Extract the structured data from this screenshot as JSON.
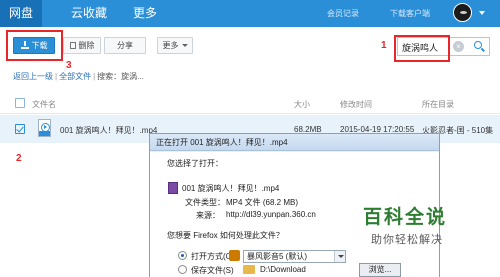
{
  "nav": {
    "tabs": [
      "网盘",
      "云收藏",
      "更多"
    ],
    "right_links": [
      "会员记录",
      "下载客户端"
    ]
  },
  "toolbar": {
    "download": "下载",
    "delete": "删除",
    "share": "分享",
    "more": "更多"
  },
  "search": {
    "value": "旋涡鸣人"
  },
  "steps": [
    "1",
    "2",
    "3"
  ],
  "breadcrumb": {
    "back": "返回上一级",
    "sep": "|",
    "all_files": "全部文件",
    "current": "搜索：旋涡..."
  },
  "table": {
    "headers": {
      "name": "文件名",
      "size": "大小",
      "modified": "修改时间",
      "location": "所在目录"
    },
    "row": {
      "name": "001 旋涡鸣人！拜见！.mp4",
      "size": "68.2MB",
      "modified": "2015-04-19 17:20:55",
      "location": "火影忍者-国 - 510集"
    }
  },
  "dialog": {
    "title": "正在打开 001 旋涡鸣人！拜见！.mp4",
    "chosen": "您选择了打开：",
    "file_name": "001 旋涡鸣人！拜见！.mp4",
    "type_label": "文件类型：",
    "type_value": "MP4 文件 (68.2 MB)",
    "source_label": "来源：",
    "source_value": "http://dl39.yunpan.360.cn",
    "question": "您想要 Firefox 如何处理此文件？",
    "open_with": "打开方式(O)",
    "open_app": "暴风影音5 (默认)",
    "save_file": "保存文件(S)",
    "save_path": "D:\\Download",
    "browse": "浏览..."
  },
  "watermark": {
    "title": "百科全说",
    "subtitle": "助你轻松解决"
  },
  "colors": {
    "nav": "#2b8fd8",
    "highlight": "#e8262a",
    "watermark": "#2e7d32"
  }
}
